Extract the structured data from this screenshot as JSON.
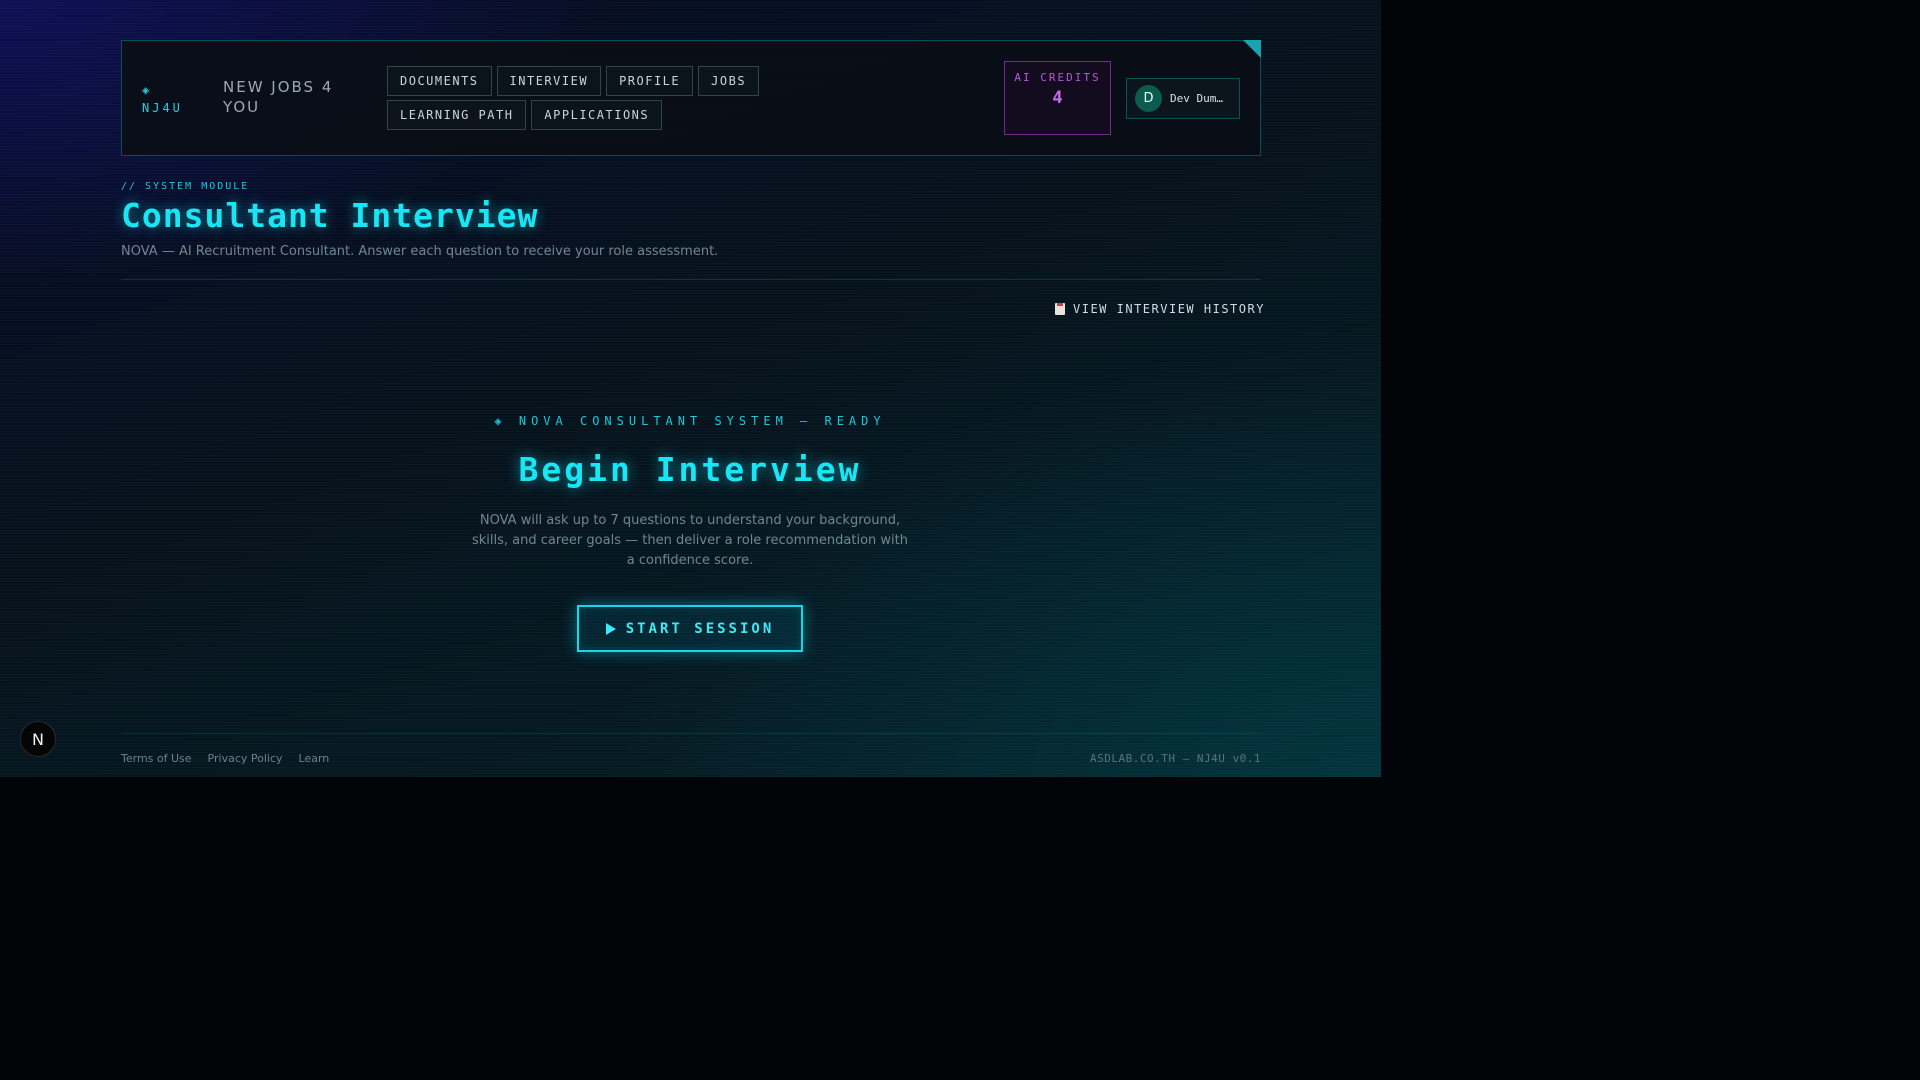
{
  "nav": {
    "brand": "◈ NJ4U",
    "brand_sub": "NEW JOBS 4 YOU",
    "links": [
      {
        "label": "DOCUMENTS"
      },
      {
        "label": "INTERVIEW"
      },
      {
        "label": "PROFILE"
      },
      {
        "label": "JOBS"
      },
      {
        "label": "LEARNING PATH"
      },
      {
        "label": "APPLICATIONS"
      }
    ],
    "credits_label": "AI CREDITS",
    "credits_value": "4",
    "user_initial": "D",
    "user_name": "Dev Dum…"
  },
  "header": {
    "module_tag": "// SYSTEM MODULE",
    "title": "Consultant Interview",
    "subtitle": "NOVA — AI Recruitment Consultant. Answer each question to receive your role assessment.",
    "history_label": "VIEW INTERVIEW HISTORY"
  },
  "main": {
    "status": "◈ NOVA CONSULTANT SYSTEM — READY",
    "heading": "Begin Interview",
    "description": "NOVA will ask up to 7 questions to understand your background, skills, and career goals — then deliver a role recommendation with a confidence score.",
    "start_label": "START SESSION"
  },
  "footer": {
    "links": [
      "Terms of Use",
      "Privacy Policy",
      "Learn"
    ],
    "version": "ASDLAB.CO.TH — NJ4U v0.1"
  },
  "badge": {
    "letter": "N"
  },
  "colors": {
    "accent": "#19e6f5",
    "credits": "#c86af0",
    "background": "#030408"
  }
}
